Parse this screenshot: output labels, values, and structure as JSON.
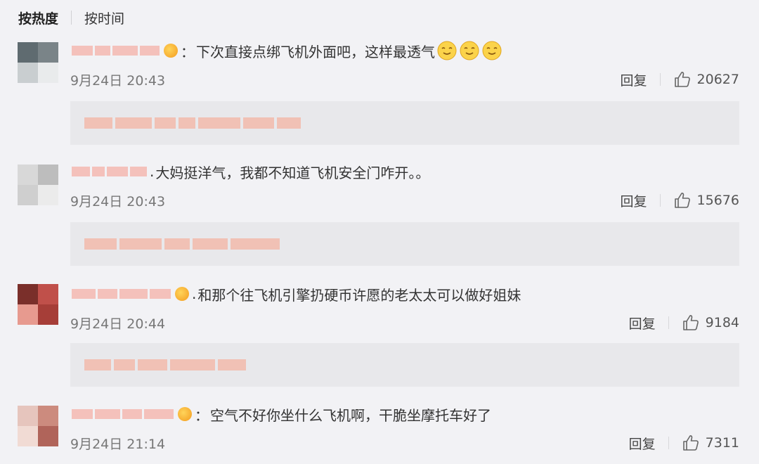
{
  "sort": {
    "hot_label": "按热度",
    "time_label": "按时间"
  },
  "comments": [
    {
      "separator": "：",
      "content": "下次直接点绑飞机外面吧，这样最透气",
      "has_emoji": true,
      "time": "9月24日 20:43",
      "reply_label": "回复",
      "likes": "20627"
    },
    {
      "separator": ".",
      "content": "大妈挺洋气，我都不知道飞机安全门咋开。。",
      "has_emoji": false,
      "time": "9月24日 20:43",
      "reply_label": "回复",
      "likes": "15676"
    },
    {
      "separator": ".",
      "content": "和那个往飞机引擎扔硬币许愿的老太太可以做好姐妹",
      "has_emoji": false,
      "time": "9月24日 20:44",
      "reply_label": "回复",
      "likes": "9184"
    },
    {
      "separator": "：",
      "content": "空气不好你坐什么飞机啊，干脆坐摩托车好了",
      "has_emoji": false,
      "time": "9月24日 21:14",
      "reply_label": "回复",
      "likes": "7311"
    }
  ],
  "colors": {
    "background": "#f2f2f5",
    "reply_box": "#e8e8eb",
    "blurred_text": "#f2b6a8"
  }
}
